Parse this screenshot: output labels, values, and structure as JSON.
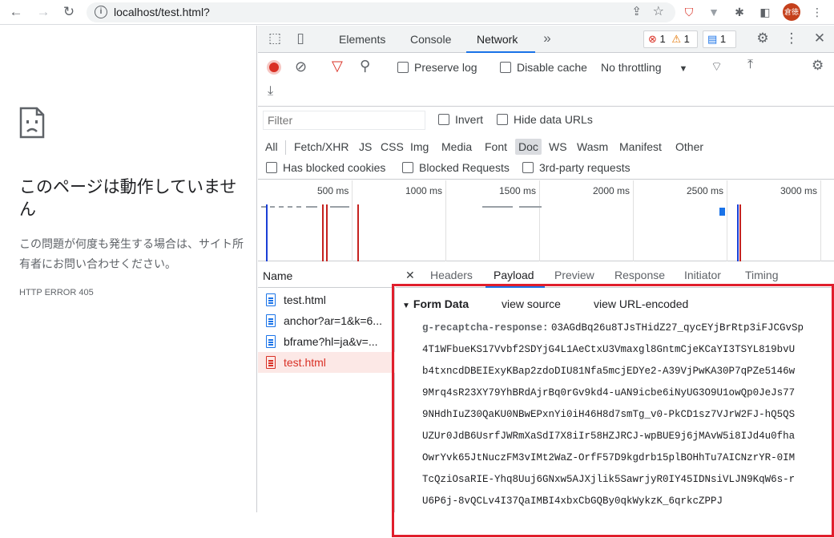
{
  "browser": {
    "url": "localhost/test.html?",
    "avatar_text": "倉徳"
  },
  "page": {
    "title": "このページは動作していません",
    "description": "この問題が何度も発生する場合は、サイト所有者にお問い合わせください。",
    "error_code": "HTTP ERROR 405"
  },
  "devtools": {
    "tabs": [
      "Elements",
      "Console",
      "Network"
    ],
    "active_tab": "Network",
    "errors": "1",
    "warnings": "1",
    "messages": "1",
    "toolbar": {
      "preserve_log": "Preserve log",
      "disable_cache": "Disable cache",
      "throttling": "No throttling"
    },
    "filter": {
      "placeholder": "Filter",
      "invert": "Invert",
      "hide_data_urls": "Hide data URLs",
      "types": [
        "All",
        "Fetch/XHR",
        "JS",
        "CSS",
        "Img",
        "Media",
        "Font",
        "Doc",
        "WS",
        "Wasm",
        "Manifest",
        "Other"
      ],
      "selected_type": "Doc",
      "has_blocked_cookies": "Has blocked cookies",
      "blocked_requests": "Blocked Requests",
      "third_party": "3rd-party requests"
    },
    "timeline": {
      "labels": [
        "500 ms",
        "1000 ms",
        "1500 ms",
        "2000 ms",
        "2500 ms",
        "3000 ms"
      ]
    },
    "requests": {
      "header": "Name",
      "items": [
        {
          "name": "test.html",
          "status": "ok"
        },
        {
          "name": "anchor?ar=1&k=6...",
          "status": "ok"
        },
        {
          "name": "bframe?hl=ja&v=...",
          "status": "ok"
        },
        {
          "name": "test.html",
          "status": "error"
        }
      ]
    },
    "detail": {
      "tabs": [
        "Headers",
        "Payload",
        "Preview",
        "Response",
        "Initiator",
        "Timing"
      ],
      "active_tab": "Payload",
      "form_data": {
        "title": "Form Data",
        "view_source": "view source",
        "view_url_encoded": "view URL-encoded",
        "key": "g-recaptcha-response:",
        "value_lines": [
          "03AGdBq26u8TJsTHidZ27_qycEYjBrRtp3iFJCGvSp",
          "4T1WFbueKS17Vvbf2SDYjG4L1AeCtxU3Vmaxgl8GntmCjeKCaYI3TSYL819bvU",
          "b4txncdDBEIExyKBap2zdoDIU81Nfa5mcjEDYe2-A39VjPwKA30P7qPZe5146w",
          "9Mrq4sR23XY79YhBRdAjrBq0rGv9kd4-uAN9icbe6iNyUG3O9U1owQp0JeJs77",
          "9NHdhIuZ30QaKU0NBwEPxnYi0iH46H8d7smTg_v0-PkCD1sz7VJrW2FJ-hQ5QS",
          "UZUr0JdB6UsrfJWRmXaSdI7X8iIr58HZJRCJ-wpBUE9j6jMAvW5i8IJd4u0fha",
          "OwrYvk65JtNuczFM3vIMt2WaZ-OrfF57D9kgdrb15plBOHhTu7AICNzrYR-0IM",
          "TcQziOsaRIE-Yhq8Uuj6GNxw5AJXjlik5SawrjyR0IY45IDNsiVLJN9KqW6s-r",
          "U6P6j-8vQCLv4I37QaIMBI4xbxCbGQBy0qkWykzK_6qrkcZPPJ"
        ]
      }
    }
  }
}
